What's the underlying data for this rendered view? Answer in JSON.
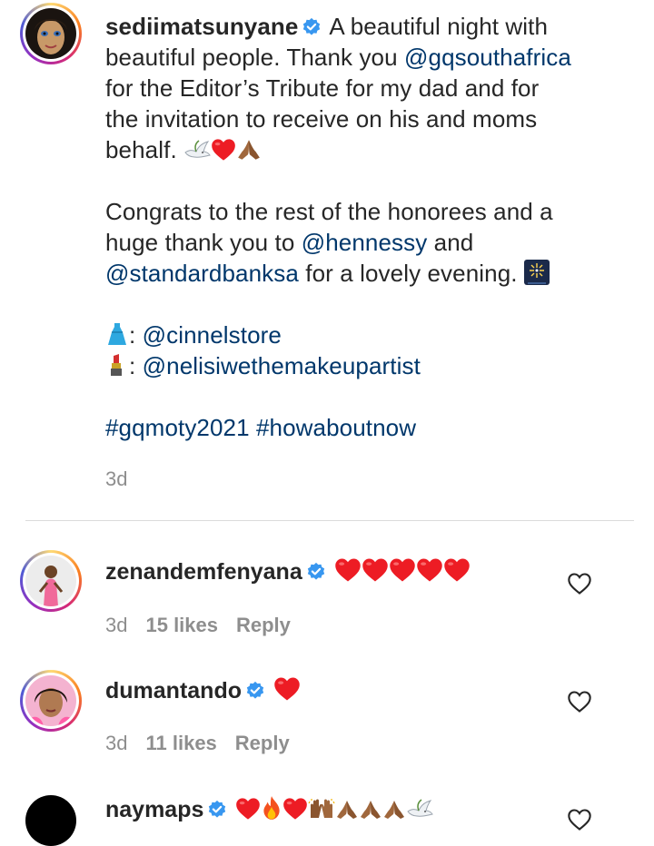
{
  "post": {
    "username": "sediimatsunyane",
    "caption_line1": "A beautiful night with",
    "caption_line2a": "beautiful people. Thank you ",
    "caption_mention1": "@gqsouthafrica",
    "caption_line3": "for the Editor’s Tribute for my dad and for",
    "caption_line4": "the invitation to receive on his and moms",
    "caption_line5": "behalf.",
    "para2_line1": "Congrats to the rest of the honorees and a",
    "para2_line2a": "huge thank you to ",
    "mention_hennessy": "@hennessy",
    "para2_line2b": " and",
    "mention_standardbank": "@standardbanksa",
    "para2_line3b": " for a lovely evening.",
    "credit1_sep": ": ",
    "credit1_mention": "@cinnelstore",
    "credit2_sep": ": ",
    "credit2_mention": "@nelisiwethemakeupartist",
    "hashtag1": "#gqmoty2021",
    "hashtag2": "#howaboutnow",
    "time": "3d"
  },
  "comments": [
    {
      "username": "zenandemfenyana",
      "time": "3d",
      "likes": "15 likes",
      "reply": "Reply"
    },
    {
      "username": "dumantando",
      "time": "3d",
      "likes": "11 likes",
      "reply": "Reply"
    },
    {
      "username": "naymaps"
    }
  ],
  "colors": {
    "link": "#00376b",
    "verified": "#3897f0",
    "heart": "#ed1c24",
    "muted": "#8e8e8e"
  },
  "icons": [
    "verified-badge-icon",
    "dove-icon",
    "red-heart-icon",
    "praying-hands-icon",
    "fireworks-icon",
    "dress-icon",
    "lipstick-icon",
    "fire-icon",
    "raising-hands-icon",
    "heart-outline-icon"
  ]
}
